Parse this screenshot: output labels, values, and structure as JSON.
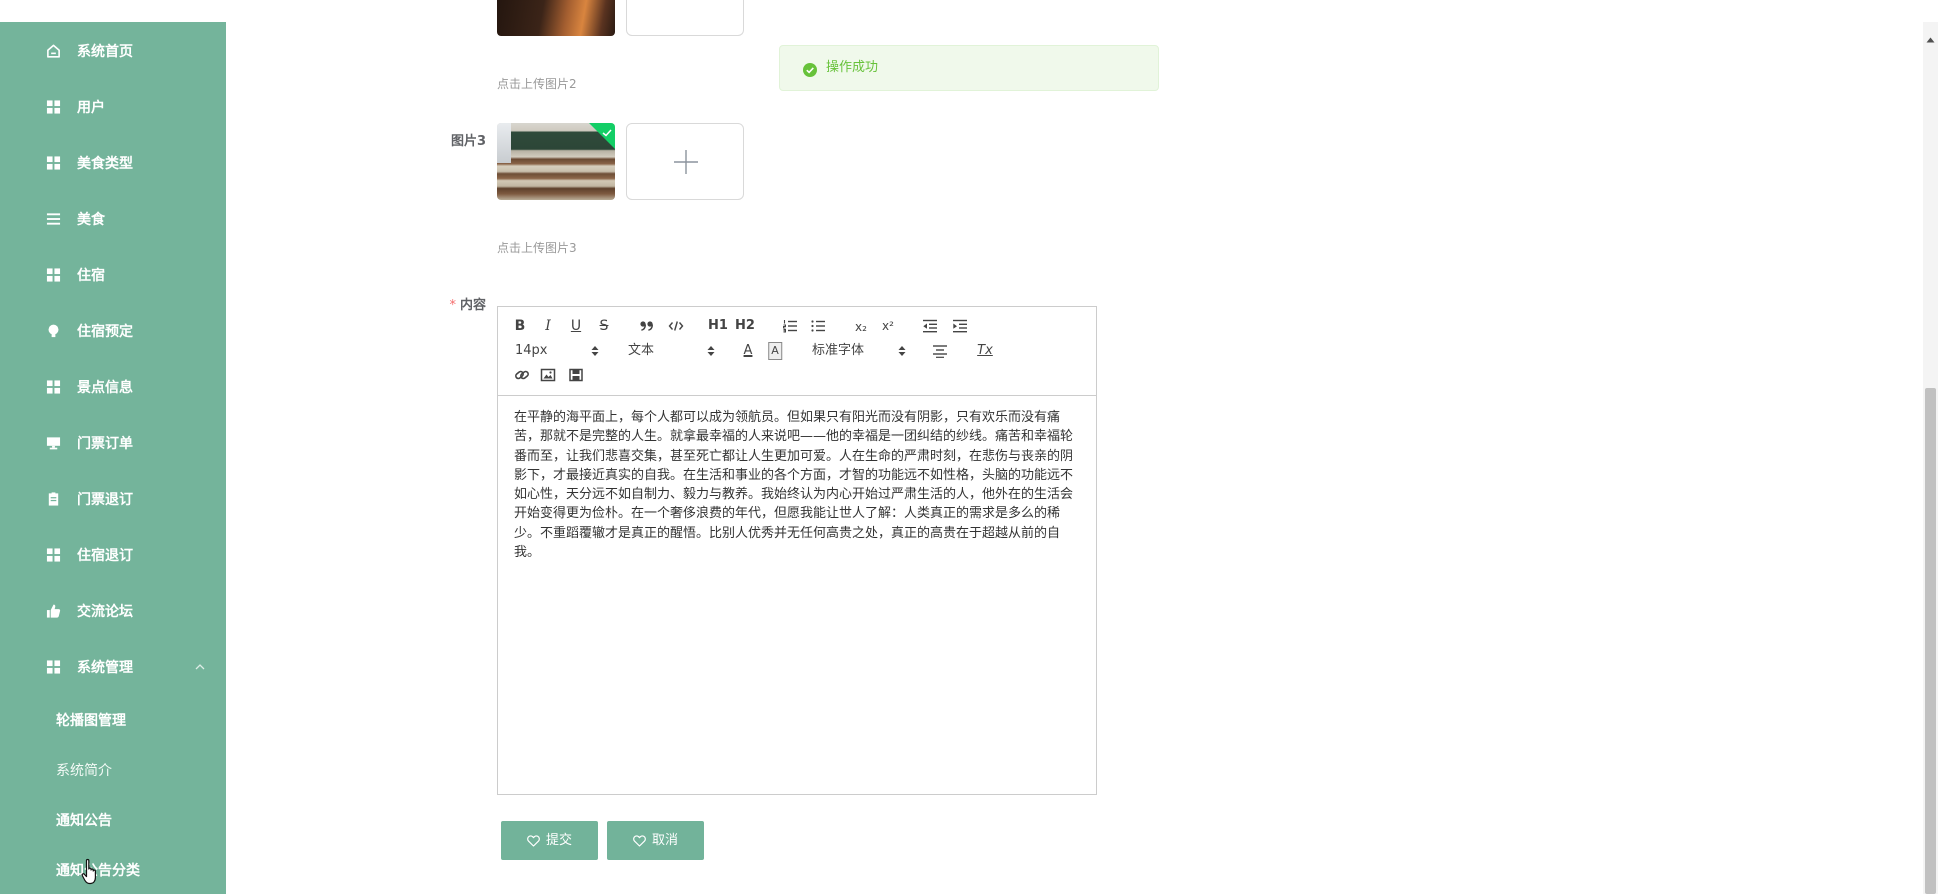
{
  "sidebar": {
    "items": [
      {
        "label": "系统首页",
        "icon": "home-icon"
      },
      {
        "label": "用户",
        "icon": "grid-icon"
      },
      {
        "label": "美食类型",
        "icon": "grid-icon"
      },
      {
        "label": "美食",
        "icon": "list-icon"
      },
      {
        "label": "住宿",
        "icon": "grid-icon"
      },
      {
        "label": "住宿预定",
        "icon": "lightbulb-icon"
      },
      {
        "label": "景点信息",
        "icon": "grid-icon"
      },
      {
        "label": "门票订单",
        "icon": "monitor-icon"
      },
      {
        "label": "门票退订",
        "icon": "clipboard-icon"
      },
      {
        "label": "住宿退订",
        "icon": "grid-icon"
      },
      {
        "label": "交流论坛",
        "icon": "thumbs-up-icon"
      },
      {
        "label": "系统管理",
        "icon": "grid-icon",
        "expanded": true
      }
    ],
    "submenu": [
      "轮播图管理",
      "系统简介",
      "通知公告",
      "通知公告分类"
    ]
  },
  "form": {
    "image2_hint": "点击上传图片2",
    "image3_label": "图片3",
    "image3_hint": "点击上传图片3",
    "content_label": "内容",
    "required_mark": "*"
  },
  "toast": {
    "message": "操作成功",
    "type": "success",
    "icon": "check-circle-icon"
  },
  "editor": {
    "toolbar": {
      "bold": "B",
      "italic": "I",
      "underline": "U",
      "strike": "S",
      "header1": "H1",
      "header2": "H2",
      "subscript": "x₂",
      "superscript": "x²",
      "font_size": "14px",
      "block_format": "文本",
      "text_color": "A",
      "background_color": "A",
      "font_select": "标准字体",
      "clear_format": "Tx"
    },
    "icons": [
      "quote-icon",
      "code-icon",
      "ordered-list-icon",
      "bullet-list-icon",
      "outdent-icon",
      "indent-icon",
      "align-icon",
      "link-icon",
      "image-icon",
      "video-icon"
    ],
    "lines": [
      "在平静的海平面上，每个人都可以成为领航员。但如果只有阳光而没有阴影，只有欢乐而没有痛",
      "苦，那就不是完整的人生。就拿最幸福的人来说吧——他的幸福是一团纠结的纱线。痛苦和幸福轮",
      "番而至，让我们悲喜交集，甚至死亡都让人生更加可爱。人在生命的严肃时刻，在悲伤与丧亲的阴",
      "影下，才最接近真实的自我。在生活和事业的各个方面，才智的功能远不如性格，头脑的功能远不",
      "如心性，天分远不如自制力、毅力与教养。我始终认为内心开始过严肃生活的人，他外在的生活会",
      "开始变得更为俭朴。在一个奢侈浪费的年代，但愿我能让世人了解：人类真正的需求是多么的稀",
      "少。不重蹈覆辙才是真正的醒悟。比别人优秀并无任何高贵之处，真正的高贵在于超越从前的自",
      "我。"
    ]
  },
  "actions": {
    "submit": "提交",
    "cancel": "取消",
    "icon": "heart-icon"
  },
  "colors": {
    "sidebar": "#74b49b",
    "button": "#72b39a",
    "success": "#67c23a",
    "required": "#f56c6c",
    "upload_badge": "#13ce66"
  }
}
